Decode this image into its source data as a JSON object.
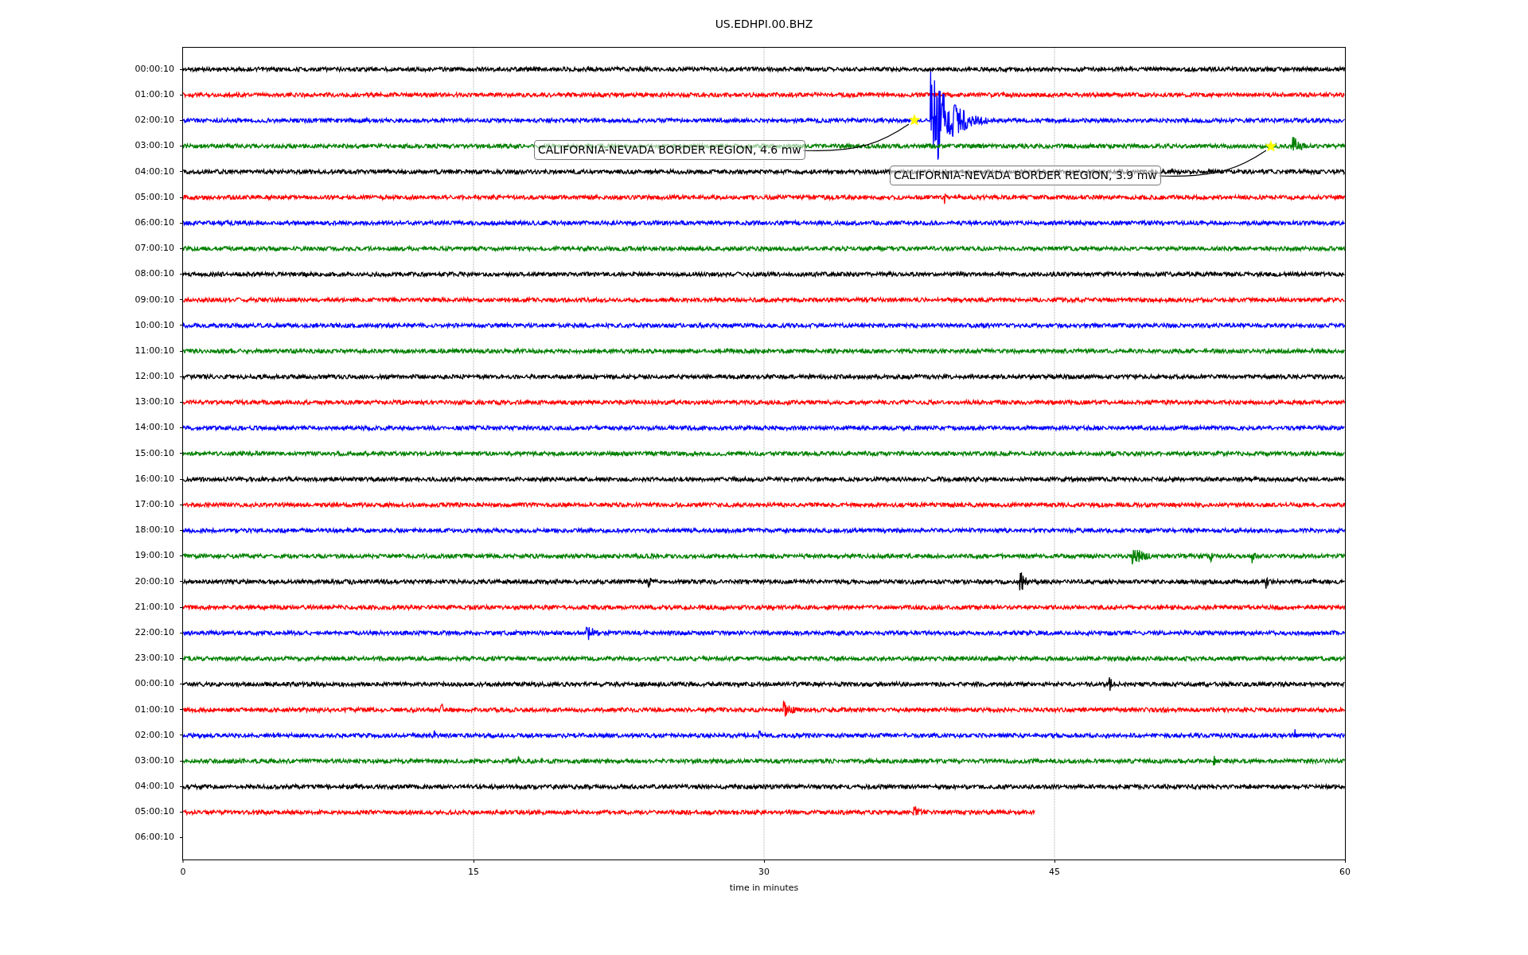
{
  "plot": {
    "title": "US.EDHPI.00.BHZ",
    "xlabel": "time in minutes",
    "xticks": [
      "0",
      "15",
      "30",
      "45",
      "60"
    ],
    "rows": [
      {
        "label": "00:00:10",
        "color": "#000000"
      },
      {
        "label": "01:00:10",
        "color": "#ff0000"
      },
      {
        "label": "02:00:10",
        "color": "#0000ff"
      },
      {
        "label": "03:00:10",
        "color": "#008000"
      },
      {
        "label": "04:00:10",
        "color": "#000000"
      },
      {
        "label": "05:00:10",
        "color": "#ff0000"
      },
      {
        "label": "06:00:10",
        "color": "#0000ff"
      },
      {
        "label": "07:00:10",
        "color": "#008000"
      },
      {
        "label": "08:00:10",
        "color": "#000000"
      },
      {
        "label": "09:00:10",
        "color": "#ff0000"
      },
      {
        "label": "10:00:10",
        "color": "#0000ff"
      },
      {
        "label": "11:00:10",
        "color": "#008000"
      },
      {
        "label": "12:00:10",
        "color": "#000000"
      },
      {
        "label": "13:00:10",
        "color": "#ff0000"
      },
      {
        "label": "14:00:10",
        "color": "#0000ff"
      },
      {
        "label": "15:00:10",
        "color": "#008000"
      },
      {
        "label": "16:00:10",
        "color": "#000000"
      },
      {
        "label": "17:00:10",
        "color": "#ff0000"
      },
      {
        "label": "18:00:10",
        "color": "#0000ff"
      },
      {
        "label": "19:00:10",
        "color": "#008000"
      },
      {
        "label": "20:00:10",
        "color": "#000000"
      },
      {
        "label": "21:00:10",
        "color": "#ff0000"
      },
      {
        "label": "22:00:10",
        "color": "#0000ff"
      },
      {
        "label": "23:00:10",
        "color": "#008000"
      },
      {
        "label": "00:00:10",
        "color": "#000000"
      },
      {
        "label": "01:00:10",
        "color": "#ff0000"
      },
      {
        "label": "02:00:10",
        "color": "#0000ff"
      },
      {
        "label": "03:00:10",
        "color": "#008000"
      },
      {
        "label": "04:00:10",
        "color": "#000000"
      },
      {
        "label": "05:00:10",
        "color": "#ff0000"
      },
      {
        "label": "06:00:10"
      }
    ],
    "annotations": [
      {
        "text": "CALIFORNIA-NEVADA BORDER REGION, 4.6 mw"
      },
      {
        "text": "CALIFORNIA-NEVADA BORDER REGION, 3.9 mw"
      }
    ]
  }
}
